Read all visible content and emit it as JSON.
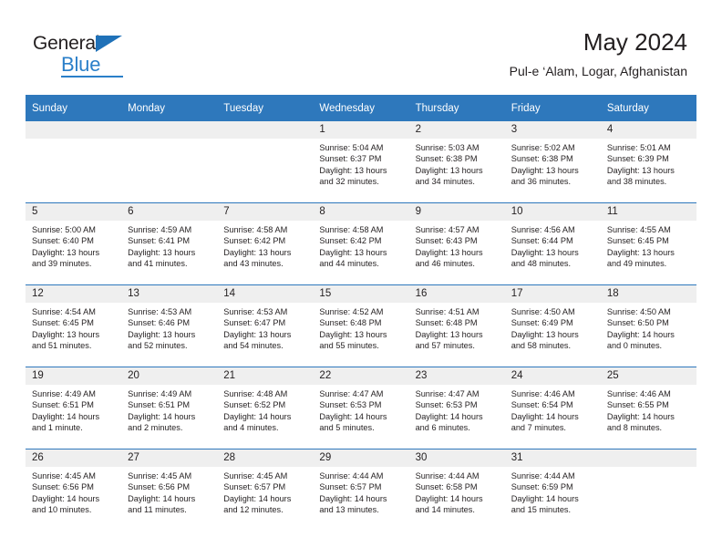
{
  "brand": {
    "name_dark": "General",
    "name_blue": "Blue",
    "accent_color": "#2a7fc9",
    "triangle_color": "#1f71b8"
  },
  "header": {
    "title": "May 2024",
    "subtitle": "Pul-e ‘Alam, Logar, Afghanistan"
  },
  "calendar": {
    "header_bg": "#2e78bc",
    "daynum_bg": "#efefef",
    "weekday_headers": [
      "Sunday",
      "Monday",
      "Tuesday",
      "Wednesday",
      "Thursday",
      "Friday",
      "Saturday"
    ],
    "weeks": [
      [
        {
          "day": "",
          "sunrise": "",
          "sunset": "",
          "daylight1": "",
          "daylight2": "",
          "empty": true
        },
        {
          "day": "",
          "sunrise": "",
          "sunset": "",
          "daylight1": "",
          "daylight2": "",
          "empty": true
        },
        {
          "day": "",
          "sunrise": "",
          "sunset": "",
          "daylight1": "",
          "daylight2": "",
          "empty": true
        },
        {
          "day": "1",
          "sunrise": "Sunrise: 5:04 AM",
          "sunset": "Sunset: 6:37 PM",
          "daylight1": "Daylight: 13 hours",
          "daylight2": "and 32 minutes."
        },
        {
          "day": "2",
          "sunrise": "Sunrise: 5:03 AM",
          "sunset": "Sunset: 6:38 PM",
          "daylight1": "Daylight: 13 hours",
          "daylight2": "and 34 minutes."
        },
        {
          "day": "3",
          "sunrise": "Sunrise: 5:02 AM",
          "sunset": "Sunset: 6:38 PM",
          "daylight1": "Daylight: 13 hours",
          "daylight2": "and 36 minutes."
        },
        {
          "day": "4",
          "sunrise": "Sunrise: 5:01 AM",
          "sunset": "Sunset: 6:39 PM",
          "daylight1": "Daylight: 13 hours",
          "daylight2": "and 38 minutes."
        }
      ],
      [
        {
          "day": "5",
          "sunrise": "Sunrise: 5:00 AM",
          "sunset": "Sunset: 6:40 PM",
          "daylight1": "Daylight: 13 hours",
          "daylight2": "and 39 minutes."
        },
        {
          "day": "6",
          "sunrise": "Sunrise: 4:59 AM",
          "sunset": "Sunset: 6:41 PM",
          "daylight1": "Daylight: 13 hours",
          "daylight2": "and 41 minutes."
        },
        {
          "day": "7",
          "sunrise": "Sunrise: 4:58 AM",
          "sunset": "Sunset: 6:42 PM",
          "daylight1": "Daylight: 13 hours",
          "daylight2": "and 43 minutes."
        },
        {
          "day": "8",
          "sunrise": "Sunrise: 4:58 AM",
          "sunset": "Sunset: 6:42 PM",
          "daylight1": "Daylight: 13 hours",
          "daylight2": "and 44 minutes."
        },
        {
          "day": "9",
          "sunrise": "Sunrise: 4:57 AM",
          "sunset": "Sunset: 6:43 PM",
          "daylight1": "Daylight: 13 hours",
          "daylight2": "and 46 minutes."
        },
        {
          "day": "10",
          "sunrise": "Sunrise: 4:56 AM",
          "sunset": "Sunset: 6:44 PM",
          "daylight1": "Daylight: 13 hours",
          "daylight2": "and 48 minutes."
        },
        {
          "day": "11",
          "sunrise": "Sunrise: 4:55 AM",
          "sunset": "Sunset: 6:45 PM",
          "daylight1": "Daylight: 13 hours",
          "daylight2": "and 49 minutes."
        }
      ],
      [
        {
          "day": "12",
          "sunrise": "Sunrise: 4:54 AM",
          "sunset": "Sunset: 6:45 PM",
          "daylight1": "Daylight: 13 hours",
          "daylight2": "and 51 minutes."
        },
        {
          "day": "13",
          "sunrise": "Sunrise: 4:53 AM",
          "sunset": "Sunset: 6:46 PM",
          "daylight1": "Daylight: 13 hours",
          "daylight2": "and 52 minutes."
        },
        {
          "day": "14",
          "sunrise": "Sunrise: 4:53 AM",
          "sunset": "Sunset: 6:47 PM",
          "daylight1": "Daylight: 13 hours",
          "daylight2": "and 54 minutes."
        },
        {
          "day": "15",
          "sunrise": "Sunrise: 4:52 AM",
          "sunset": "Sunset: 6:48 PM",
          "daylight1": "Daylight: 13 hours",
          "daylight2": "and 55 minutes."
        },
        {
          "day": "16",
          "sunrise": "Sunrise: 4:51 AM",
          "sunset": "Sunset: 6:48 PM",
          "daylight1": "Daylight: 13 hours",
          "daylight2": "and 57 minutes."
        },
        {
          "day": "17",
          "sunrise": "Sunrise: 4:50 AM",
          "sunset": "Sunset: 6:49 PM",
          "daylight1": "Daylight: 13 hours",
          "daylight2": "and 58 minutes."
        },
        {
          "day": "18",
          "sunrise": "Sunrise: 4:50 AM",
          "sunset": "Sunset: 6:50 PM",
          "daylight1": "Daylight: 14 hours",
          "daylight2": "and 0 minutes."
        }
      ],
      [
        {
          "day": "19",
          "sunrise": "Sunrise: 4:49 AM",
          "sunset": "Sunset: 6:51 PM",
          "daylight1": "Daylight: 14 hours",
          "daylight2": "and 1 minute."
        },
        {
          "day": "20",
          "sunrise": "Sunrise: 4:49 AM",
          "sunset": "Sunset: 6:51 PM",
          "daylight1": "Daylight: 14 hours",
          "daylight2": "and 2 minutes."
        },
        {
          "day": "21",
          "sunrise": "Sunrise: 4:48 AM",
          "sunset": "Sunset: 6:52 PM",
          "daylight1": "Daylight: 14 hours",
          "daylight2": "and 4 minutes."
        },
        {
          "day": "22",
          "sunrise": "Sunrise: 4:47 AM",
          "sunset": "Sunset: 6:53 PM",
          "daylight1": "Daylight: 14 hours",
          "daylight2": "and 5 minutes."
        },
        {
          "day": "23",
          "sunrise": "Sunrise: 4:47 AM",
          "sunset": "Sunset: 6:53 PM",
          "daylight1": "Daylight: 14 hours",
          "daylight2": "and 6 minutes."
        },
        {
          "day": "24",
          "sunrise": "Sunrise: 4:46 AM",
          "sunset": "Sunset: 6:54 PM",
          "daylight1": "Daylight: 14 hours",
          "daylight2": "and 7 minutes."
        },
        {
          "day": "25",
          "sunrise": "Sunrise: 4:46 AM",
          "sunset": "Sunset: 6:55 PM",
          "daylight1": "Daylight: 14 hours",
          "daylight2": "and 8 minutes."
        }
      ],
      [
        {
          "day": "26",
          "sunrise": "Sunrise: 4:45 AM",
          "sunset": "Sunset: 6:56 PM",
          "daylight1": "Daylight: 14 hours",
          "daylight2": "and 10 minutes."
        },
        {
          "day": "27",
          "sunrise": "Sunrise: 4:45 AM",
          "sunset": "Sunset: 6:56 PM",
          "daylight1": "Daylight: 14 hours",
          "daylight2": "and 11 minutes."
        },
        {
          "day": "28",
          "sunrise": "Sunrise: 4:45 AM",
          "sunset": "Sunset: 6:57 PM",
          "daylight1": "Daylight: 14 hours",
          "daylight2": "and 12 minutes."
        },
        {
          "day": "29",
          "sunrise": "Sunrise: 4:44 AM",
          "sunset": "Sunset: 6:57 PM",
          "daylight1": "Daylight: 14 hours",
          "daylight2": "and 13 minutes."
        },
        {
          "day": "30",
          "sunrise": "Sunrise: 4:44 AM",
          "sunset": "Sunset: 6:58 PM",
          "daylight1": "Daylight: 14 hours",
          "daylight2": "and 14 minutes."
        },
        {
          "day": "31",
          "sunrise": "Sunrise: 4:44 AM",
          "sunset": "Sunset: 6:59 PM",
          "daylight1": "Daylight: 14 hours",
          "daylight2": "and 15 minutes."
        },
        {
          "day": "",
          "sunrise": "",
          "sunset": "",
          "daylight1": "",
          "daylight2": "",
          "empty": true
        }
      ]
    ]
  }
}
